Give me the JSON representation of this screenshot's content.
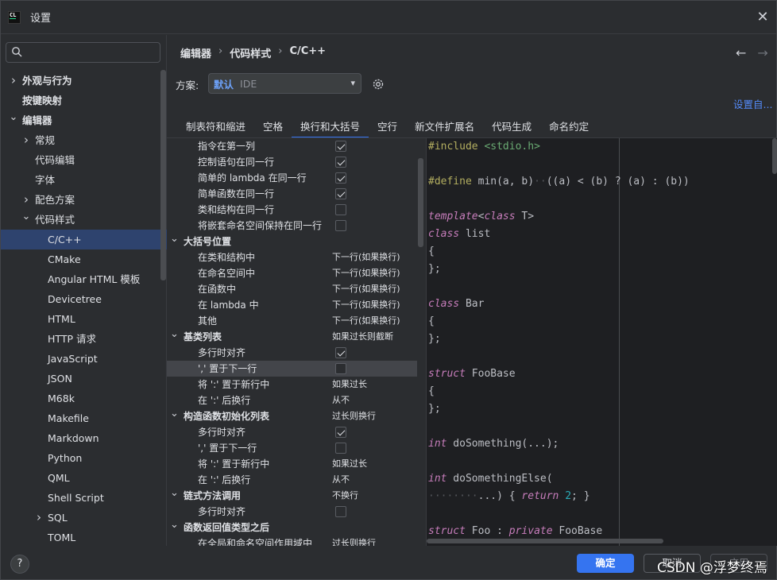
{
  "window": {
    "title": "设置",
    "logo_text": "CL"
  },
  "sidebar": {
    "search_placeholder": "",
    "items": [
      {
        "label": "外观与行为",
        "level": 0,
        "chevron": "right",
        "bold": true
      },
      {
        "label": "按键映射",
        "level": 0,
        "chevron": "",
        "bold": true
      },
      {
        "label": "编辑器",
        "level": 0,
        "chevron": "down",
        "bold": true
      },
      {
        "label": "常规",
        "level": 1,
        "chevron": "right"
      },
      {
        "label": "代码编辑",
        "level": 1,
        "chevron": ""
      },
      {
        "label": "字体",
        "level": 1,
        "chevron": ""
      },
      {
        "label": "配色方案",
        "level": 1,
        "chevron": "right"
      },
      {
        "label": "代码样式",
        "level": 1,
        "chevron": "down"
      },
      {
        "label": "C/C++",
        "level": 2,
        "chevron": "",
        "selected": true
      },
      {
        "label": "CMake",
        "level": 2,
        "chevron": ""
      },
      {
        "label": "Angular HTML 模板",
        "level": 2,
        "chevron": ""
      },
      {
        "label": "Devicetree",
        "level": 2,
        "chevron": ""
      },
      {
        "label": "HTML",
        "level": 2,
        "chevron": ""
      },
      {
        "label": "HTTP 请求",
        "level": 2,
        "chevron": ""
      },
      {
        "label": "JavaScript",
        "level": 2,
        "chevron": ""
      },
      {
        "label": "JSON",
        "level": 2,
        "chevron": ""
      },
      {
        "label": "M68k",
        "level": 2,
        "chevron": ""
      },
      {
        "label": "Makefile",
        "level": 2,
        "chevron": ""
      },
      {
        "label": "Markdown",
        "level": 2,
        "chevron": ""
      },
      {
        "label": "Python",
        "level": 2,
        "chevron": ""
      },
      {
        "label": "QML",
        "level": 2,
        "chevron": ""
      },
      {
        "label": "Shell Script",
        "level": 2,
        "chevron": ""
      },
      {
        "label": "SQL",
        "level": 2,
        "chevron": "right"
      },
      {
        "label": "TOML",
        "level": 2,
        "chevron": ""
      }
    ]
  },
  "breadcrumb": [
    "编辑器",
    "代码样式",
    "C/C++"
  ],
  "scheme": {
    "label": "方案:",
    "value": "默认",
    "sub": "IDE"
  },
  "set_from_link": "设置自...",
  "tabs": [
    {
      "label": "制表符和缩进",
      "active": false
    },
    {
      "label": "空格",
      "active": false
    },
    {
      "label": "换行和大括号",
      "active": true
    },
    {
      "label": "空行",
      "active": false
    },
    {
      "label": "新文件扩展名",
      "active": false
    },
    {
      "label": "代码生成",
      "active": false
    },
    {
      "label": "命名约定",
      "active": false
    }
  ],
  "options": [
    {
      "label": "指令在第一列",
      "level": 1,
      "checkbox": true,
      "checked": true
    },
    {
      "label": "控制语句在同一行",
      "level": 1,
      "checkbox": true,
      "checked": true
    },
    {
      "label": "简单的 lambda 在同一行",
      "level": 1,
      "checkbox": true,
      "checked": true
    },
    {
      "label": "简单函数在同一行",
      "level": 1,
      "checkbox": true,
      "checked": true
    },
    {
      "label": "类和结构在同一行",
      "level": 1,
      "checkbox": true,
      "checked": false
    },
    {
      "label": "将嵌套命名空间保持在同一行",
      "level": 1,
      "checkbox": true,
      "checked": false
    },
    {
      "label": "大括号位置",
      "level": 0,
      "group": true,
      "value": ""
    },
    {
      "label": "在类和结构中",
      "level": 1,
      "value": "下一行(如果换行)"
    },
    {
      "label": "在命名空间中",
      "level": 1,
      "value": "下一行(如果换行)"
    },
    {
      "label": "在函数中",
      "level": 1,
      "value": "下一行(如果换行)"
    },
    {
      "label": "在 lambda 中",
      "level": 1,
      "value": "下一行(如果换行)"
    },
    {
      "label": "其他",
      "level": 1,
      "value": "下一行(如果换行)"
    },
    {
      "label": "基类列表",
      "level": 0,
      "group": true,
      "value": "如果过长则截断"
    },
    {
      "label": "多行时对齐",
      "level": 1,
      "checkbox": true,
      "checked": true
    },
    {
      "label": "',' 置于下一行",
      "level": 1,
      "checkbox": true,
      "checked": false,
      "highlight": true
    },
    {
      "label": "将 ':' 置于新行中",
      "level": 1,
      "value": "如果过长"
    },
    {
      "label": "在 ':' 后换行",
      "level": 1,
      "value": "从不"
    },
    {
      "label": "构造函数初始化列表",
      "level": 0,
      "group": true,
      "value": "过长则换行"
    },
    {
      "label": "多行时对齐",
      "level": 1,
      "checkbox": true,
      "checked": true
    },
    {
      "label": "',' 置于下一行",
      "level": 1,
      "checkbox": true,
      "checked": false
    },
    {
      "label": "将 ':' 置于新行中",
      "level": 1,
      "value": "如果过长"
    },
    {
      "label": "在 ':' 后换行",
      "level": 1,
      "value": "从不"
    },
    {
      "label": "链式方法调用",
      "level": 0,
      "group": true,
      "value": "不换行"
    },
    {
      "label": "多行时对齐",
      "level": 1,
      "checkbox": true,
      "checked": false
    },
    {
      "label": "函数返回值类型之后",
      "level": 0,
      "group": true,
      "value": ""
    },
    {
      "label": "在全局和命名空间作用域中",
      "level": 1,
      "value": "过长则换行"
    }
  ],
  "code_lines": [
    [
      {
        "t": "#include",
        "c": "k-pre"
      },
      {
        "t": " <stdio.h>",
        "c": "k-inc"
      }
    ],
    [],
    [
      {
        "t": "#define",
        "c": "k-pre"
      },
      {
        "t": " min(a, b)",
        "c": ""
      },
      {
        "t": "··",
        "c": "dots"
      },
      {
        "t": "((a) < (b) ? (a) : (b))",
        "c": ""
      }
    ],
    [],
    [
      {
        "t": "template",
        "c": "k-kw2"
      },
      {
        "t": "<",
        "c": ""
      },
      {
        "t": "class",
        "c": "k-kw2"
      },
      {
        "t": " T>",
        "c": ""
      }
    ],
    [
      {
        "t": "class",
        "c": "k-kw2"
      },
      {
        "t": " list",
        "c": ""
      }
    ],
    [
      {
        "t": "{",
        "c": ""
      }
    ],
    [
      {
        "t": "};",
        "c": ""
      }
    ],
    [],
    [
      {
        "t": "class",
        "c": "k-kw2"
      },
      {
        "t": " Bar",
        "c": ""
      }
    ],
    [
      {
        "t": "{",
        "c": ""
      }
    ],
    [
      {
        "t": "};",
        "c": ""
      }
    ],
    [],
    [
      {
        "t": "struct",
        "c": "k-kw2"
      },
      {
        "t": " FooBase",
        "c": ""
      }
    ],
    [
      {
        "t": "{",
        "c": ""
      }
    ],
    [
      {
        "t": "};",
        "c": ""
      }
    ],
    [],
    [
      {
        "t": "int",
        "c": "k-kw2"
      },
      {
        "t": " doSomething(...);",
        "c": ""
      }
    ],
    [],
    [
      {
        "t": "int",
        "c": "k-kw2"
      },
      {
        "t": " doSomethingElse(",
        "c": ""
      }
    ],
    [
      {
        "t": "········",
        "c": "dots"
      },
      {
        "t": "...) { ",
        "c": ""
      },
      {
        "t": "return",
        "c": "k-kw2"
      },
      {
        "t": " ",
        "c": ""
      },
      {
        "t": "2",
        "c": "k-num"
      },
      {
        "t": "; }",
        "c": ""
      }
    ],
    [],
    [
      {
        "t": "struct",
        "c": "k-kw2"
      },
      {
        "t": " Foo : ",
        "c": ""
      },
      {
        "t": "private",
        "c": "k-kw2"
      },
      {
        "t": " FooBase",
        "c": ""
      }
    ]
  ],
  "footer": {
    "help": "?",
    "ok": "确定",
    "cancel": "取消",
    "apply": "应用"
  },
  "watermark": "CSDN @浮梦终焉",
  "colors": {
    "accent": "#3574f0",
    "selected": "#2e436e",
    "link": "#548af7"
  }
}
